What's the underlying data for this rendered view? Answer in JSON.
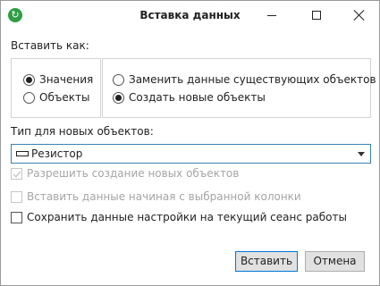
{
  "dialog": {
    "title": "Вставка данных",
    "window_buttons": [
      "minimize",
      "maximize",
      "close"
    ]
  },
  "paste_as": {
    "label": "Вставить как:",
    "options": [
      {
        "label": "Значения",
        "selected": true
      },
      {
        "label": "Объекты",
        "selected": false
      }
    ]
  },
  "mode": {
    "options": [
      {
        "label": "Заменить данные существующих объектов",
        "selected": false
      },
      {
        "label": "Создать новые объекты",
        "selected": true
      }
    ]
  },
  "new_object_type": {
    "label": "Тип для новых объектов:",
    "value": "Резистор",
    "icon": "resistor-icon"
  },
  "options": [
    {
      "label": "Разрешить создание новых объектов",
      "checked": true,
      "enabled": false
    },
    {
      "label": "Вставить данные начиная с выбранной колонки",
      "checked": false,
      "enabled": false
    },
    {
      "label": "Сохранить данные настройки на текущий сеанс работы",
      "checked": false,
      "enabled": true
    }
  ],
  "buttons": {
    "insert": "Вставить",
    "cancel": "Отмена"
  },
  "colors": {
    "accent": "#0078d7",
    "app_icon": "#2e9e44",
    "disabled_text": "#a5a5a5"
  }
}
